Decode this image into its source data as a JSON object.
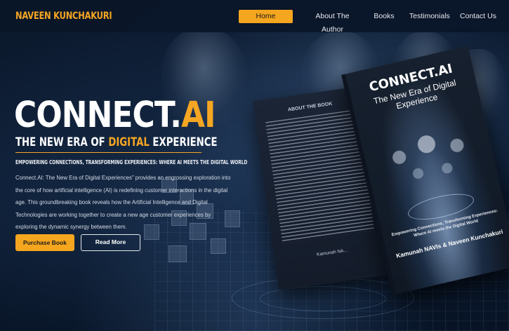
{
  "header": {
    "brand": "NAVEEN KUNCHAKURI",
    "nav": [
      "Home",
      "About The Author",
      "Books",
      "Testimonials",
      "Contact Us"
    ],
    "active": "Home"
  },
  "hero": {
    "title_main": "CONNECT.",
    "title_accent": "AI",
    "subtitle_pre": "THE NEW ERA OF ",
    "subtitle_accent": "DIGITAL",
    "subtitle_post": " EXPERIENCE",
    "tagline": "EMPOWERING CONNECTIONS, TRANSFORMING EXPERIENCES: WHERE AI MEETS THE DIGITAL WORLD",
    "description": "Connect.AI: The New Era of Digital Experiences\" provides an engrossing exploration into the core of how artificial intelligence (AI) is redefining customer interactions in the digital age. This groundbreaking book reveals how the Artificial Intelligence and Digital Technologies are working together to create a new age customer experiences by exploring the dynamic synergy between them.",
    "purchase_label": "Purchase Book",
    "read_more_label": "Read More"
  },
  "book": {
    "back_heading": "ABOUT THE BOOK",
    "back_author": "Kamunah NA...",
    "front_title": "CONNECT.AI",
    "front_subtitle": "The New Era of Digital Experience",
    "front_tagline": "Empowering Connections, Transforming Experiences: Where AI meets the Digital World",
    "front_authors": "Kamunah NAVIs & Naveen Kunchakuri"
  },
  "colors": {
    "accent": "#f5a623",
    "background": "#0a1628"
  }
}
